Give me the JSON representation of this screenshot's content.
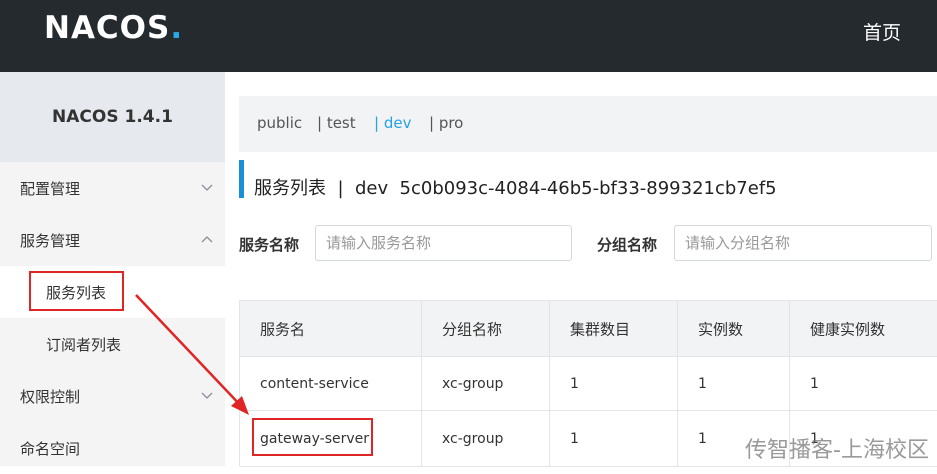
{
  "header": {
    "logo_text": "NACOS",
    "logo_dot": ".",
    "home_link": "首页"
  },
  "sidebar": {
    "version": "NACOS 1.4.1",
    "items": [
      {
        "label": "配置管理",
        "chevron": "chevron-down-icon"
      },
      {
        "label": "服务管理",
        "chevron": "chevron-up-icon"
      },
      {
        "label": "权限控制",
        "chevron": "chevron-down-icon"
      },
      {
        "label": "命名空间"
      }
    ],
    "submenu": [
      {
        "label": "服务列表",
        "active": true
      },
      {
        "label": "订阅者列表",
        "active": false
      }
    ]
  },
  "namespaces": {
    "items": [
      "public",
      "| test",
      "| dev",
      "| pro"
    ],
    "active": "| dev"
  },
  "page": {
    "title": "服务列表  |  dev  5c0b093c-4084-46b5-bf33-899321cb7ef5"
  },
  "filters": {
    "service_name_label": "服务名称",
    "service_name_placeholder": "请输入服务名称",
    "group_name_label": "分组名称",
    "group_name_placeholder": "请输入分组名称"
  },
  "table": {
    "columns": [
      "服务名",
      "分组名称",
      "集群数目",
      "实例数",
      "健康实例数"
    ],
    "rows": [
      [
        "content-service",
        "xc-group",
        "1",
        "1",
        "1"
      ],
      [
        "gateway-server",
        "xc-group",
        "1",
        "1",
        "1"
      ]
    ]
  },
  "watermark": "传智播客-上海校区",
  "colors": {
    "topbar": "#252a2f",
    "accent": "#27a1e3",
    "annotation": "#e02525"
  }
}
